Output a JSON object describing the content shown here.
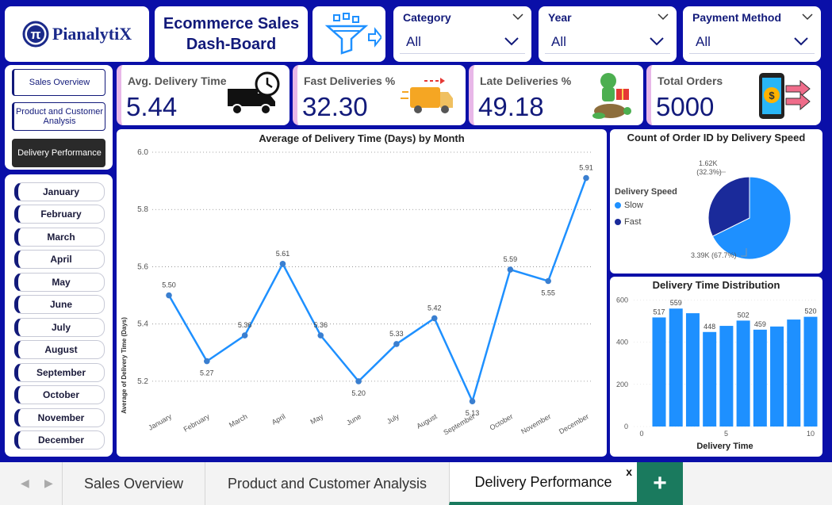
{
  "brand": {
    "logo_symbol": "π",
    "logo_text": "PianalytiX"
  },
  "header": {
    "title": "Ecommerce Sales\nDash-Board"
  },
  "filters": [
    {
      "title": "Category",
      "value": "All"
    },
    {
      "title": "Year",
      "value": "All"
    },
    {
      "title": "Payment Method",
      "value": "All"
    }
  ],
  "nav": {
    "items": [
      {
        "label": "Sales Overview"
      },
      {
        "label": "Product and Customer Analysis"
      },
      {
        "label": "Delivery Performance"
      }
    ]
  },
  "months": [
    "January",
    "February",
    "March",
    "April",
    "May",
    "June",
    "July",
    "August",
    "September",
    "October",
    "November",
    "December"
  ],
  "kpis": [
    {
      "label": "Avg. Delivery Time",
      "value": "5.44"
    },
    {
      "label": "Fast Deliveries %",
      "value": "32.30"
    },
    {
      "label": "Late Deliveries %",
      "value": "49.18"
    },
    {
      "label": "Total Orders",
      "value": "5000"
    }
  ],
  "line_chart": {
    "title": "Average of Delivery Time (Days) by Month",
    "ylabel": "Average of Delivery Time (Days)"
  },
  "pie_chart": {
    "title": "Count of Order ID by Delivery Speed",
    "legend_title": "Delivery Speed",
    "legend": [
      {
        "name": "Slow"
      },
      {
        "name": "Fast"
      }
    ],
    "label_fast": "1.62K\n(32.3%)",
    "label_slow": "3.39K (67.7%)"
  },
  "hist_chart": {
    "title": "Delivery Time Distribution",
    "xlabel": "Delivery Time"
  },
  "colors": {
    "primary": "#0a0fa8",
    "series": "#1e90ff",
    "fast": "#1a2a9a",
    "accent": "#1a7a5e"
  },
  "chart_data": [
    {
      "type": "line",
      "title": "Average of Delivery Time (Days) by Month",
      "xlabel": "",
      "ylabel": "Average of Delivery Time (Days)",
      "categories": [
        "January",
        "February",
        "March",
        "April",
        "May",
        "June",
        "July",
        "August",
        "September",
        "October",
        "November",
        "December"
      ],
      "values": [
        5.5,
        5.27,
        5.36,
        5.61,
        5.36,
        5.2,
        5.33,
        5.42,
        5.13,
        5.59,
        5.55,
        5.91
      ],
      "data_labels": [
        "5.50",
        "5.27",
        "5.36",
        "5.61",
        "5.36",
        "5.20",
        "5.33",
        "5.42",
        "5.13",
        "5.59",
        "5.55",
        "5.91"
      ],
      "ylim": [
        5.1,
        6.0
      ],
      "yticks": [
        "5.2",
        "5.4",
        "5.6",
        "5.8",
        "6.0"
      ],
      "ytick_values": [
        5.2,
        5.4,
        5.6,
        5.8,
        6.0
      ],
      "grid": true
    },
    {
      "type": "pie",
      "title": "Count of Order ID by Delivery Speed",
      "categories": [
        "Slow",
        "Fast"
      ],
      "values": [
        3385,
        1615
      ],
      "data_labels": [
        "3.39K (67.7%)",
        "1.62K (32.3%)"
      ],
      "legend": "left"
    },
    {
      "type": "bar",
      "title": "Delivery Time Distribution",
      "xlabel": "Delivery Time",
      "ylabel": "",
      "x": [
        1,
        2,
        3,
        4,
        5,
        6,
        7,
        8,
        9,
        10
      ],
      "values": [
        517,
        559,
        537,
        448,
        477,
        502,
        459,
        474,
        507,
        520
      ],
      "data_labels": [
        "517",
        "559",
        "",
        "448",
        "",
        "502",
        "459",
        "",
        "",
        "520"
      ],
      "ylim": [
        0,
        620
      ],
      "yticks": [
        "0",
        "200",
        "400",
        "600"
      ],
      "ytick_values": [
        0,
        200,
        400,
        600
      ],
      "xticks": [
        "0",
        "5",
        "10"
      ],
      "xtick_values": [
        0,
        5,
        10
      ]
    }
  ],
  "tabs": [
    {
      "label": "Sales Overview"
    },
    {
      "label": "Product and Customer Analysis"
    },
    {
      "label": "Delivery Performance",
      "close": "x"
    }
  ],
  "tab_add_label": "+",
  "tab_nav": {
    "prev": "◀",
    "next": "▶"
  }
}
